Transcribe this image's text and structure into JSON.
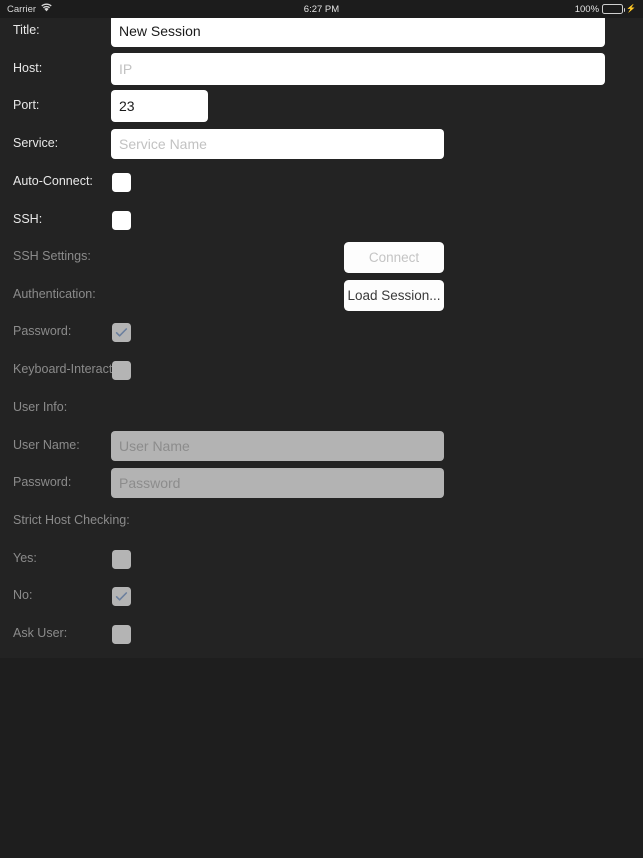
{
  "statusbar": {
    "carrier": "Carrier",
    "wifi_icon": "wifi-icon",
    "time": "6:27 PM",
    "battery_percent": "100%",
    "battery_icon": "battery-full-icon",
    "charging_icon": "lightning-bolt-icon"
  },
  "form": {
    "rows": [
      {
        "label": "Title:",
        "type": "text",
        "value": "New Session",
        "placeholder": ""
      },
      {
        "label": "Host:",
        "type": "text",
        "value": "",
        "placeholder": "IP"
      },
      {
        "label": "Port:",
        "type": "text",
        "value": "23",
        "placeholder": ""
      },
      {
        "label": "Service:",
        "type": "text",
        "value": "",
        "placeholder": "Service Name"
      },
      {
        "label": "Auto-Connect:",
        "type": "checkbox",
        "checked": false,
        "enabled": true
      },
      {
        "label": "SSH:",
        "type": "checkbox",
        "checked": false,
        "enabled": true
      },
      {
        "label": "SSH Settings:",
        "type": "button",
        "button_label": "Connect",
        "enabled": false
      },
      {
        "label": "Authentication:",
        "type": "button",
        "button_label": "Load Session...",
        "enabled": true
      },
      {
        "label": "Password:",
        "type": "checkbox",
        "checked": true,
        "enabled": false
      },
      {
        "label": "Keyboard-Interactive:",
        "type": "checkbox",
        "checked": false,
        "enabled": false
      },
      {
        "label": "User Info:",
        "type": "header"
      },
      {
        "label": "User Name:",
        "type": "text",
        "value": "",
        "placeholder": "User Name",
        "enabled": false
      },
      {
        "label": "Password:",
        "type": "text",
        "value": "",
        "placeholder": "Password",
        "enabled": false
      },
      {
        "label": "Strict Host Checking:",
        "type": "header"
      },
      {
        "label": "Yes:",
        "type": "checkbox",
        "checked": false,
        "enabled": false
      },
      {
        "label": "No:",
        "type": "checkbox",
        "checked": true,
        "enabled": false
      },
      {
        "label": "Ask User:",
        "type": "checkbox",
        "checked": false,
        "enabled": false
      }
    ]
  },
  "colors": {
    "background": "#1e1e1e",
    "form_background": "#232323",
    "field_background": "#ffffff",
    "field_disabled": "#b3b3b3",
    "label": "#e8e8e8",
    "label_dim": "#8b8b8b",
    "checkmark": "#6b7f9e",
    "battery_green": "#4cd662"
  }
}
